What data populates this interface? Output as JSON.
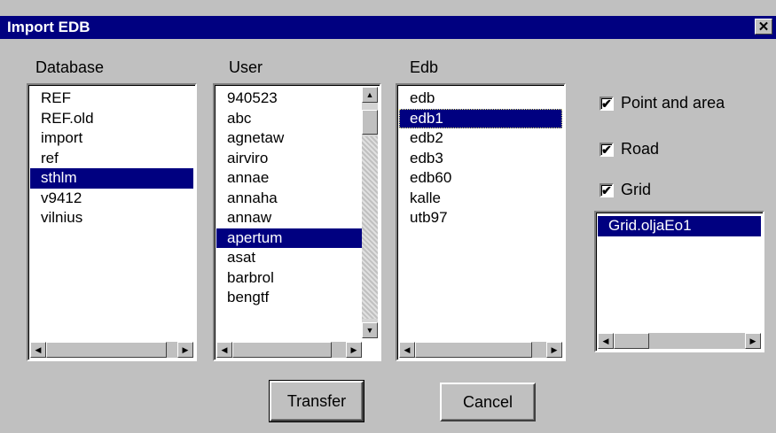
{
  "window": {
    "title": "Import EDB",
    "close_glyph": "✕"
  },
  "database": {
    "label": "Database",
    "items": [
      "REF",
      "REF.old",
      "import",
      "ref",
      "sthlm",
      "v9412",
      "vilnius"
    ],
    "selected": "sthlm"
  },
  "user": {
    "label": "User",
    "items": [
      "940523",
      "abc",
      "agnetaw",
      "airviro",
      "annae",
      "annaha",
      "annaw",
      "apertum",
      "asat",
      "barbrol",
      "bengtf"
    ],
    "selected": "apertum"
  },
  "edb": {
    "label": "Edb",
    "items": [
      "edb",
      "edb1",
      "edb2",
      "edb3",
      "edb60",
      "kalle",
      "utb97"
    ],
    "selected": "edb1"
  },
  "options": {
    "point_and_area": {
      "label": "Point and area",
      "checked": true
    },
    "road": {
      "label": "Road",
      "checked": true
    },
    "grid": {
      "label": "Grid",
      "checked": true
    }
  },
  "grid_list": {
    "items": [
      "Grid.oljaEo1"
    ],
    "selected": "Grid.oljaEo1"
  },
  "buttons": {
    "transfer": "Transfer",
    "cancel": "Cancel"
  },
  "glyphs": {
    "check": "✔",
    "left": "◀",
    "right": "▶",
    "up": "▲",
    "down": "▼"
  },
  "colors": {
    "selection": "#000080",
    "face": "#c0c0c0"
  }
}
